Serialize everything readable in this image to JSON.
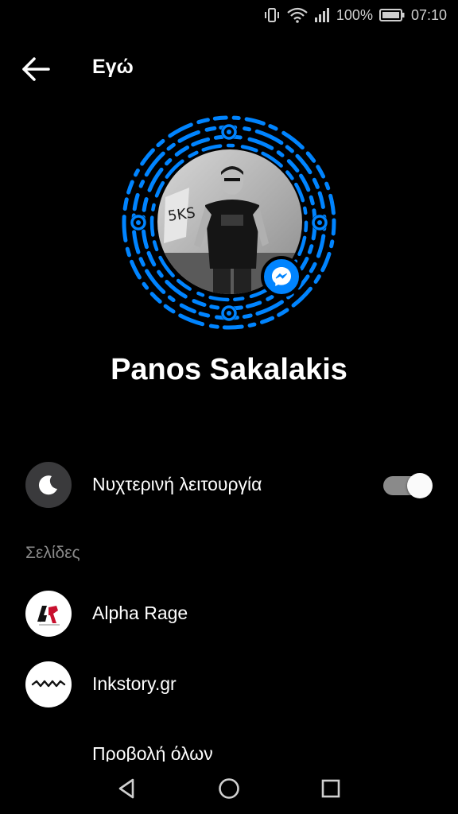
{
  "status_bar": {
    "battery_percent": "100%",
    "time": "07:10",
    "battery_level": 1.0
  },
  "app_bar": {
    "title": "Εγώ"
  },
  "profile": {
    "name": "Panos Sakalakis"
  },
  "colors": {
    "messenger_blue": "#0084ff",
    "background": "#000000",
    "section_grey": "#8a8a8a"
  },
  "night_mode": {
    "label": "Νυχτερινή λειτουργία",
    "enabled": true,
    "icon": "moon-icon"
  },
  "pages_section": {
    "header": "Σελίδες",
    "items": [
      {
        "label": "Alpha Rage",
        "icon": "alpha-rage-logo"
      },
      {
        "label": "Inkstory.gr",
        "icon": "inkstory-wave-logo"
      }
    ],
    "view_all_label": "Προβολή όλων"
  },
  "nav_bar": {
    "buttons": [
      "back-triangle-icon",
      "home-circle-icon",
      "recents-square-icon"
    ]
  }
}
